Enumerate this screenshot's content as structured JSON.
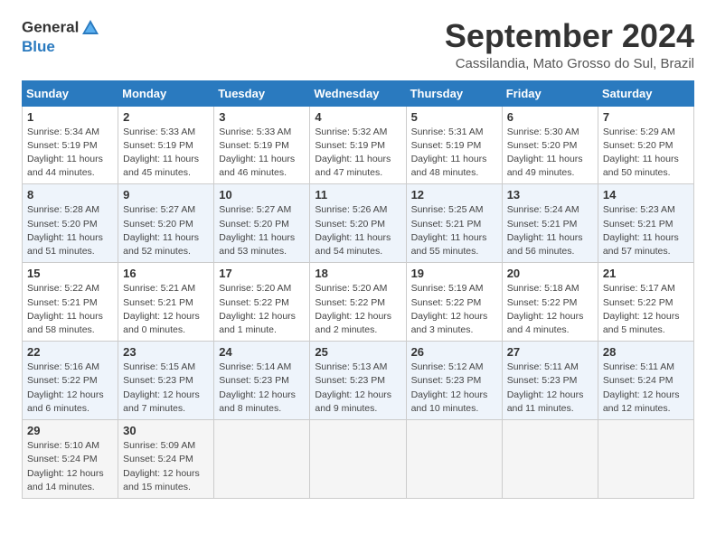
{
  "header": {
    "logo_line1": "General",
    "logo_line2": "Blue",
    "month": "September 2024",
    "location": "Cassilandia, Mato Grosso do Sul, Brazil"
  },
  "weekdays": [
    "Sunday",
    "Monday",
    "Tuesday",
    "Wednesday",
    "Thursday",
    "Friday",
    "Saturday"
  ],
  "weeks": [
    [
      {
        "day": 1,
        "rise": "5:34 AM",
        "set": "5:19 PM",
        "hours": "11 hours and 44 minutes."
      },
      {
        "day": 2,
        "rise": "5:33 AM",
        "set": "5:19 PM",
        "hours": "11 hours and 45 minutes."
      },
      {
        "day": 3,
        "rise": "5:33 AM",
        "set": "5:19 PM",
        "hours": "11 hours and 46 minutes."
      },
      {
        "day": 4,
        "rise": "5:32 AM",
        "set": "5:19 PM",
        "hours": "11 hours and 47 minutes."
      },
      {
        "day": 5,
        "rise": "5:31 AM",
        "set": "5:19 PM",
        "hours": "11 hours and 48 minutes."
      },
      {
        "day": 6,
        "rise": "5:30 AM",
        "set": "5:20 PM",
        "hours": "11 hours and 49 minutes."
      },
      {
        "day": 7,
        "rise": "5:29 AM",
        "set": "5:20 PM",
        "hours": "11 hours and 50 minutes."
      }
    ],
    [
      {
        "day": 8,
        "rise": "5:28 AM",
        "set": "5:20 PM",
        "hours": "11 hours and 51 minutes."
      },
      {
        "day": 9,
        "rise": "5:27 AM",
        "set": "5:20 PM",
        "hours": "11 hours and 52 minutes."
      },
      {
        "day": 10,
        "rise": "5:27 AM",
        "set": "5:20 PM",
        "hours": "11 hours and 53 minutes."
      },
      {
        "day": 11,
        "rise": "5:26 AM",
        "set": "5:20 PM",
        "hours": "11 hours and 54 minutes."
      },
      {
        "day": 12,
        "rise": "5:25 AM",
        "set": "5:21 PM",
        "hours": "11 hours and 55 minutes."
      },
      {
        "day": 13,
        "rise": "5:24 AM",
        "set": "5:21 PM",
        "hours": "11 hours and 56 minutes."
      },
      {
        "day": 14,
        "rise": "5:23 AM",
        "set": "5:21 PM",
        "hours": "11 hours and 57 minutes."
      }
    ],
    [
      {
        "day": 15,
        "rise": "5:22 AM",
        "set": "5:21 PM",
        "hours": "11 hours and 58 minutes."
      },
      {
        "day": 16,
        "rise": "5:21 AM",
        "set": "5:21 PM",
        "hours": "12 hours and 0 minutes."
      },
      {
        "day": 17,
        "rise": "5:20 AM",
        "set": "5:22 PM",
        "hours": "12 hours and 1 minute."
      },
      {
        "day": 18,
        "rise": "5:20 AM",
        "set": "5:22 PM",
        "hours": "12 hours and 2 minutes."
      },
      {
        "day": 19,
        "rise": "5:19 AM",
        "set": "5:22 PM",
        "hours": "12 hours and 3 minutes."
      },
      {
        "day": 20,
        "rise": "5:18 AM",
        "set": "5:22 PM",
        "hours": "12 hours and 4 minutes."
      },
      {
        "day": 21,
        "rise": "5:17 AM",
        "set": "5:22 PM",
        "hours": "12 hours and 5 minutes."
      }
    ],
    [
      {
        "day": 22,
        "rise": "5:16 AM",
        "set": "5:22 PM",
        "hours": "12 hours and 6 minutes."
      },
      {
        "day": 23,
        "rise": "5:15 AM",
        "set": "5:23 PM",
        "hours": "12 hours and 7 minutes."
      },
      {
        "day": 24,
        "rise": "5:14 AM",
        "set": "5:23 PM",
        "hours": "12 hours and 8 minutes."
      },
      {
        "day": 25,
        "rise": "5:13 AM",
        "set": "5:23 PM",
        "hours": "12 hours and 9 minutes."
      },
      {
        "day": 26,
        "rise": "5:12 AM",
        "set": "5:23 PM",
        "hours": "12 hours and 10 minutes."
      },
      {
        "day": 27,
        "rise": "5:11 AM",
        "set": "5:23 PM",
        "hours": "12 hours and 11 minutes."
      },
      {
        "day": 28,
        "rise": "5:11 AM",
        "set": "5:24 PM",
        "hours": "12 hours and 12 minutes."
      }
    ],
    [
      {
        "day": 29,
        "rise": "5:10 AM",
        "set": "5:24 PM",
        "hours": "12 hours and 14 minutes."
      },
      {
        "day": 30,
        "rise": "5:09 AM",
        "set": "5:24 PM",
        "hours": "12 hours and 15 minutes."
      },
      null,
      null,
      null,
      null,
      null
    ]
  ]
}
